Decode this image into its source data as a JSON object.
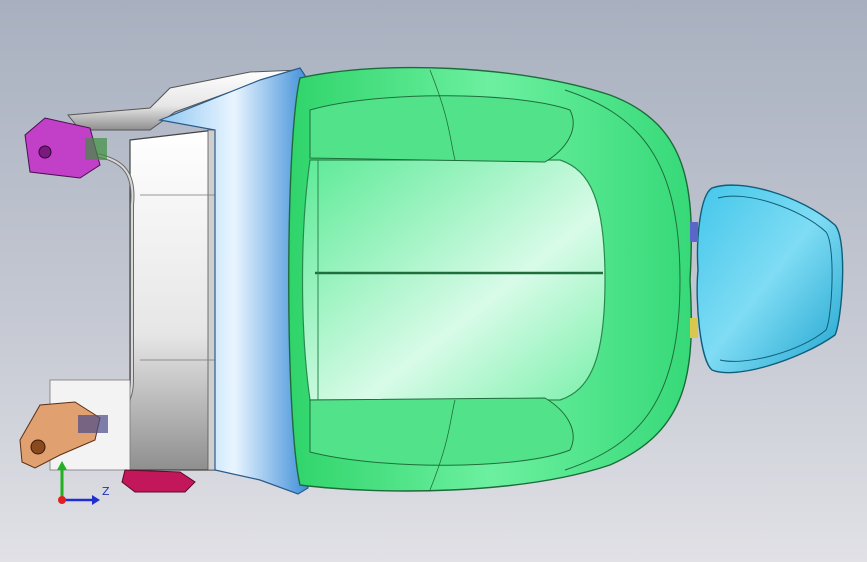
{
  "viewport": {
    "background_top": "#a8b0bf",
    "background_bottom": "#e1e1e6"
  },
  "model": {
    "parts": [
      {
        "name": "seat-cushion",
        "color": "#3ce07a"
      },
      {
        "name": "front-trim-panel",
        "color": "#5aa6e8"
      },
      {
        "name": "seat-frame",
        "color": "#d2d2d2"
      },
      {
        "name": "headrest",
        "color": "#2fb7dd"
      },
      {
        "name": "upper-mount-bracket",
        "color": "#c23fc8"
      },
      {
        "name": "lower-mount-bracket",
        "color": "#d9905a"
      },
      {
        "name": "adjuster-handle",
        "color": "#c2185b"
      }
    ]
  },
  "triad": {
    "axis_z_label": "Z",
    "x_color": "#e02020",
    "y_color": "#20b020",
    "z_color": "#2030d0"
  }
}
